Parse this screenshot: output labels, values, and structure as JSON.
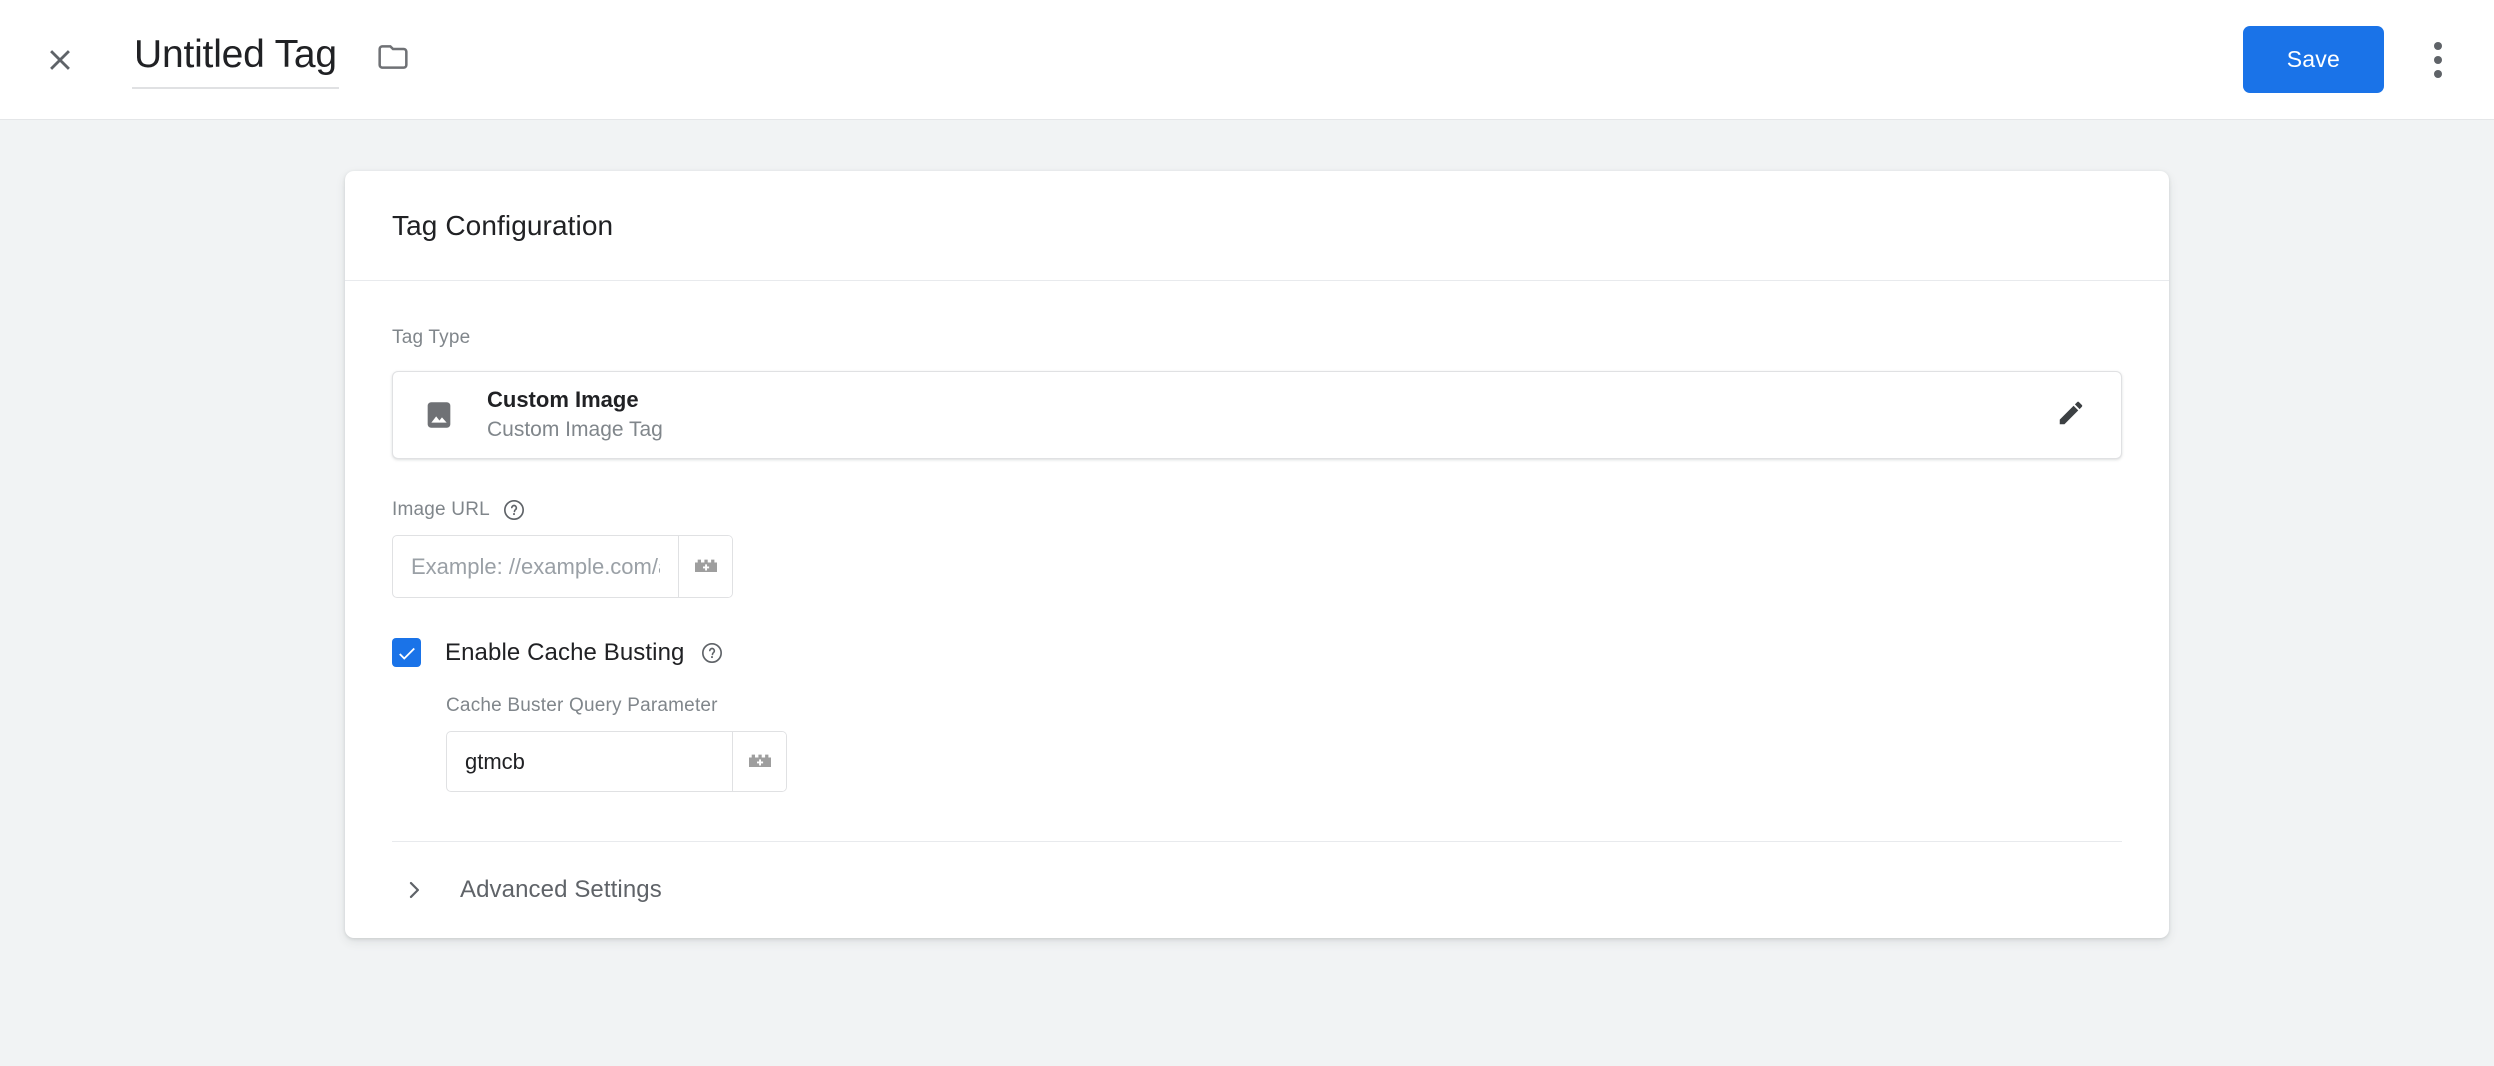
{
  "header": {
    "close_icon": "close-icon",
    "title": "Untitled Tag",
    "folder_icon": "folder-icon",
    "save_label": "Save",
    "more_icon": "more-vert-icon"
  },
  "card": {
    "title": "Tag Configuration",
    "tag_type": {
      "label": "Tag Type",
      "icon": "image-icon",
      "name": "Custom Image",
      "description": "Custom Image Tag",
      "edit_icon": "pencil-icon"
    },
    "image_url": {
      "label": "Image URL",
      "help_icon": "help-circle-icon",
      "value": "",
      "placeholder": "Example: //example.com/a.gif",
      "variable_icon": "variable-picker-icon"
    },
    "cache_busting": {
      "checked": true,
      "label": "Enable Cache Busting",
      "help_icon": "help-circle-icon",
      "param_label": "Cache Buster Query Parameter",
      "param_value": "gtmcb",
      "param_placeholder": "",
      "variable_icon": "variable-picker-icon"
    },
    "advanced": {
      "label": "Advanced Settings",
      "chevron_icon": "chevron-right-icon",
      "expanded": false
    }
  },
  "colors": {
    "accent": "#1a73e8",
    "page_bg": "#f1f3f4",
    "text_primary": "#202124",
    "text_secondary": "#80868b",
    "icon_gray": "#6f7175"
  }
}
